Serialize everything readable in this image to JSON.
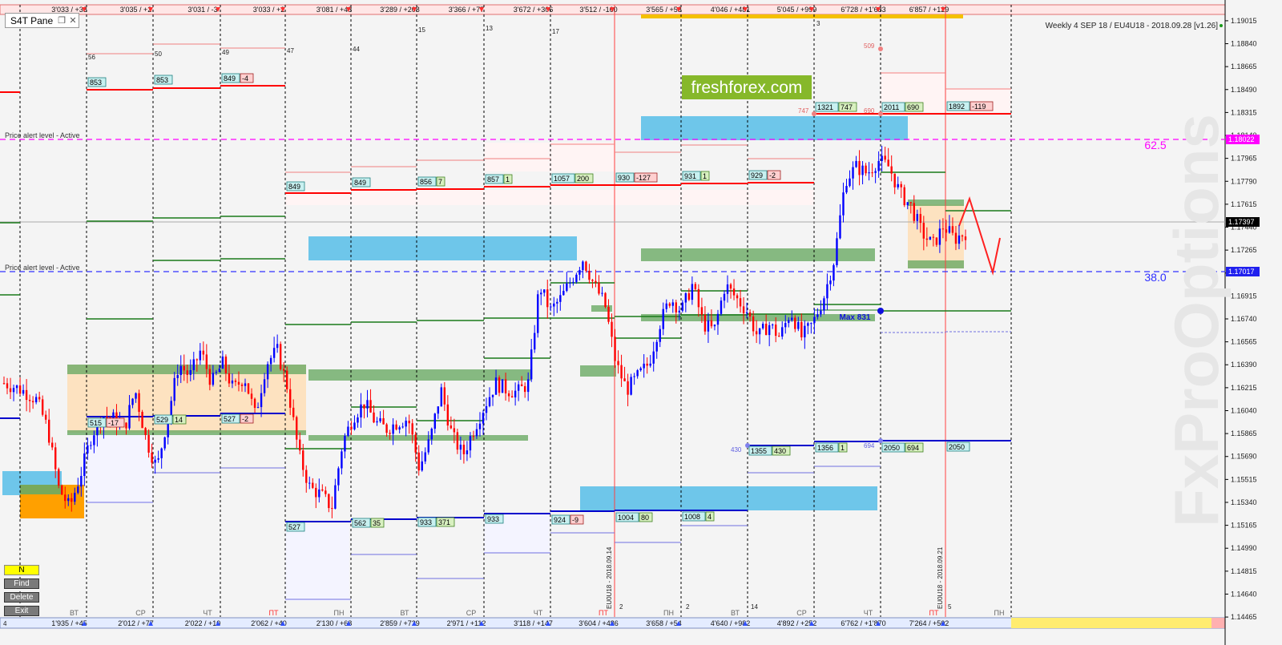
{
  "pane": {
    "title": "S4T Pane"
  },
  "info": "Weekly 4 SEP 18 / EU4U18 - 2018.09.28 [v1.26]",
  "watermark": "FxProOptions",
  "brand": "freshforex.com",
  "alerts": [
    "Price alert level - Active",
    "Price alert level - Active"
  ],
  "fibs": [
    "62.5",
    "38.0"
  ],
  "controls": [
    "N",
    "Find",
    "Delete",
    "Exit"
  ],
  "max_label": "Max 831",
  "contract_labels": [
    "EU0U18 - 2018.09.14",
    "EU0U18 - 2018.09.21"
  ],
  "top_labels": [
    "3'033 / +33",
    "3'035 / +2",
    "3'031 / -3",
    "3'033 / +2",
    "3'081 / +48",
    "3'289 / +208",
    "3'366 / +77",
    "3'672 / +306",
    "3'512 / -160",
    "3'565 / +53",
    "4'046 / +481",
    "5'045 / +999",
    "6'728 / +1'683",
    "6'857 / +129"
  ],
  "bottom_labels": [
    "1'935 / +45",
    "2'012 / +77",
    "2'022 / +10",
    "2'062 / +40",
    "2'130 / +68",
    "2'859 / +729",
    "2'971 / +112",
    "3'118 / +147",
    "3'604 / +486",
    "3'658 / +54",
    "4'640 / +982",
    "4'892 / +252",
    "6'762 / +1'870",
    "7'264 / +502"
  ],
  "small_counts": {
    "top": [
      "56",
      "50",
      "49",
      "47",
      "44",
      "15",
      "13",
      "17",
      "3"
    ],
    "bottom": [
      "2",
      "2",
      "14",
      "5"
    ],
    "first_bottom": "4",
    "orange_top": [
      "509",
      "747",
      "690"
    ],
    "blue_bottom": [
      "430",
      "694"
    ]
  },
  "day_labels": [
    "ВТ",
    "СР",
    "ЧТ",
    "ПТ",
    "ПН",
    "ВТ",
    "СР",
    "ЧТ",
    "ПТ",
    "ПН",
    "ВТ",
    "СР",
    "ЧТ",
    "ПТ",
    "ПН"
  ],
  "box_labels": {
    "red": [
      [
        "853",
        ""
      ],
      [
        "853",
        ""
      ],
      [
        "849",
        "-4"
      ],
      [
        "849",
        ""
      ],
      [
        "849",
        ""
      ],
      [
        "856",
        "7"
      ],
      [
        "857",
        "1"
      ],
      [
        "1057",
        "200"
      ],
      [
        "930",
        "-127"
      ],
      [
        "931",
        "1"
      ],
      [
        "929",
        "-2"
      ],
      [
        "1321",
        "747"
      ],
      [
        "2011",
        "690"
      ],
      [
        "1892",
        "-119"
      ]
    ],
    "blue": [
      [
        "515",
        "-17"
      ],
      [
        "529",
        "14"
      ],
      [
        "527",
        "-2"
      ],
      [
        "527",
        ""
      ],
      [
        "562",
        "35"
      ],
      [
        "933",
        "371"
      ],
      [
        "933",
        ""
      ],
      [
        "924",
        "-9"
      ],
      [
        "1004",
        "80"
      ],
      [
        "1008",
        "4"
      ],
      [
        "1355",
        "430"
      ],
      [
        "1356",
        "1"
      ],
      [
        "2050",
        "694"
      ],
      [
        "2050",
        ""
      ]
    ]
  },
  "colors": {
    "up": "#0000ff",
    "down": "#ff0000",
    "resistance": "#ff0000",
    "support": "#0000cc",
    "green_zone": "#6aaa64",
    "blue_zone": "#6ec6ea",
    "peach_zone": "#fde2c0",
    "magenta": "#ff00ff",
    "navy": "#3030ff",
    "brand": "#86b82a"
  },
  "chart_data": {
    "type": "candlestick",
    "instrument": "EU4U18",
    "y_ticks": [
      "1.19015",
      "1.18840",
      "1.18665",
      "1.18490",
      "1.18315",
      "1.18140",
      "1.17965",
      "1.17790",
      "1.17615",
      "1.17440",
      "1.17265",
      "1.17090",
      "1.16915",
      "1.16740",
      "1.16565",
      "1.16390",
      "1.16215",
      "1.16040",
      "1.15865",
      "1.15690",
      "1.15515",
      "1.15340",
      "1.15165",
      "1.14990",
      "1.14815",
      "1.14640",
      "1.14465"
    ],
    "ylim": [
      1.1438,
      1.191
    ],
    "current_price": "1.17397",
    "alert_levels": [
      "1.18022",
      "1.17017"
    ],
    "price_path": [
      1.1625,
      1.1622,
      1.1618,
      1.1612,
      1.159,
      1.1545,
      1.153,
      1.1555,
      1.1585,
      1.16,
      1.1598,
      1.159,
      1.162,
      1.1582,
      1.156,
      1.16,
      1.164,
      1.163,
      1.165,
      1.1625,
      1.164,
      1.162,
      1.163,
      1.16,
      1.164,
      1.165,
      1.162,
      1.157,
      1.1545,
      1.154,
      1.153,
      1.158,
      1.16,
      1.161,
      1.1595,
      1.159,
      1.1595,
      1.1598,
      1.156,
      1.1582,
      1.162,
      1.1585,
      1.157,
      1.159,
      1.1608,
      1.1625,
      1.162,
      1.1618,
      1.1625,
      1.17,
      1.168,
      1.169,
      1.1705,
      1.172,
      1.17,
      1.1685,
      1.164,
      1.162,
      1.163,
      1.164,
      1.167,
      1.169,
      1.168,
      1.17,
      1.167,
      1.1665,
      1.17,
      1.169,
      1.168,
      1.166,
      1.167,
      1.166,
      1.168,
      1.166,
      1.167,
      1.169,
      1.172,
      1.178,
      1.179,
      1.1785,
      1.1795,
      1.179,
      1.177,
      1.176,
      1.174,
      1.173,
      1.1745,
      1.1735,
      1.174
    ],
    "fib_labels": [
      "62.5",
      "38.0"
    ]
  }
}
